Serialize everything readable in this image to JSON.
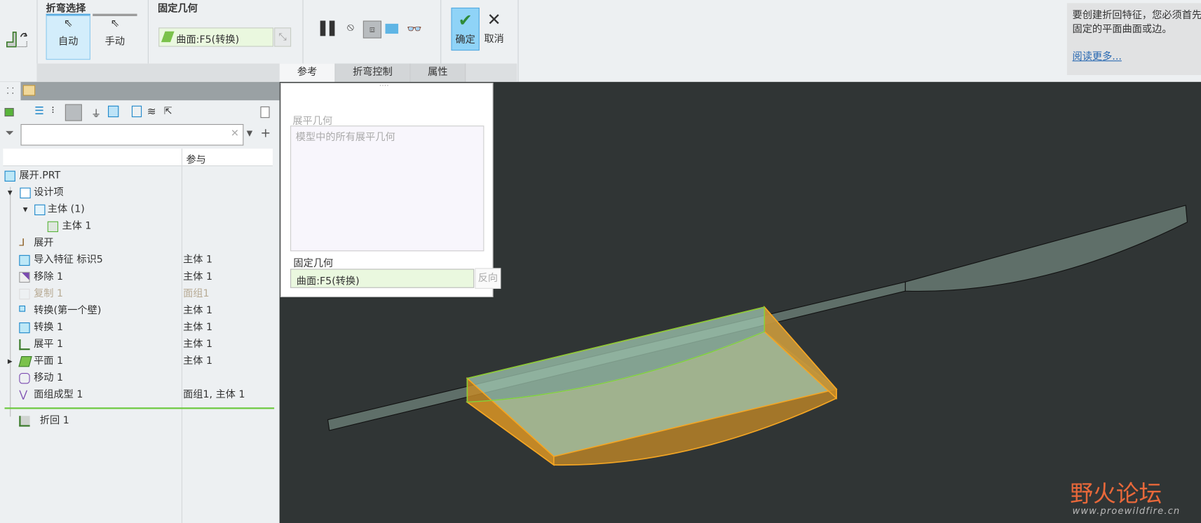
{
  "ribbon": {
    "bend_select": {
      "title": "折弯选择",
      "auto_label": "自动",
      "manual_label": "手动"
    },
    "fixed_geometry": {
      "title": "固定几何",
      "value": "曲面:F5(转换)"
    },
    "ok_label": "确定",
    "cancel_label": "取消",
    "tabs": [
      {
        "label": "参考"
      },
      {
        "label": "折弯控制"
      },
      {
        "label": "属性"
      }
    ]
  },
  "help": {
    "text_line1": "要创建折回特征，您必须首先",
    "text_line2": "固定的平面曲面或边。",
    "link": "阅读更多..."
  },
  "tree": {
    "column_header": "参与",
    "items": [
      {
        "label": "展开.PRT",
        "ref": ""
      },
      {
        "label": "设计项",
        "ref": ""
      },
      {
        "label": "主体 (1)",
        "ref": ""
      },
      {
        "label": "主体 1",
        "ref": ""
      },
      {
        "label": "展开",
        "ref": ""
      },
      {
        "label": "导入特征 标识5",
        "ref": "主体 1"
      },
      {
        "label": "移除 1",
        "ref": "主体 1"
      },
      {
        "label": "复制 1",
        "ref": "面组1"
      },
      {
        "label": "转换(第一个壁)",
        "ref": "主体 1"
      },
      {
        "label": "转换 1",
        "ref": "主体 1"
      },
      {
        "label": "展平 1",
        "ref": "主体 1"
      },
      {
        "label": "平面 1",
        "ref": "主体 1"
      },
      {
        "label": "移动 1",
        "ref": ""
      },
      {
        "label": "面组成型 1",
        "ref": "面组1, 主体 1"
      },
      {
        "label": "折回 1",
        "ref": ""
      }
    ]
  },
  "panel": {
    "flatten_label": "展平几何",
    "flatten_placeholder": "模型中的所有展平几何",
    "fixed_label": "固定几何",
    "fixed_value": "曲面:F5(转换)",
    "flip_label": "反向"
  },
  "watermark": {
    "title": "野火论坛",
    "url": "www.proewildfire.cn"
  },
  "colors": {
    "accent": "#cde8f7",
    "selection": "#eaf8df",
    "highlight": "#f5a623",
    "edge": "#7ad33a"
  }
}
